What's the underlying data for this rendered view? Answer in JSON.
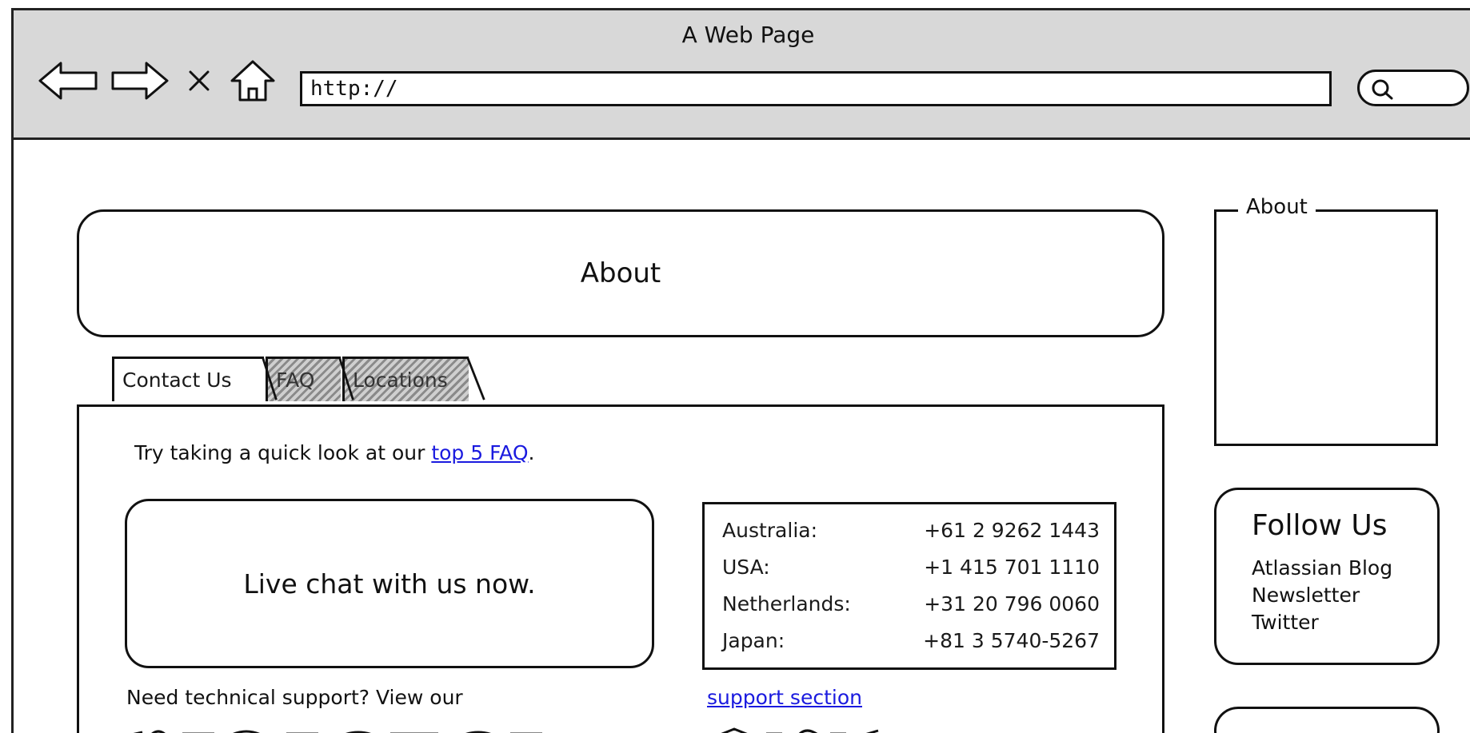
{
  "browser": {
    "window_title": "A Web Page",
    "url": "http://"
  },
  "page": {
    "header_title": "About",
    "tabs": [
      {
        "label": "Contact Us",
        "state": "active"
      },
      {
        "label": "FAQ",
        "state": "inactive"
      },
      {
        "label": "Locations",
        "state": "inactive"
      }
    ],
    "intro_text": "Try taking a quick look at our ",
    "intro_link": "top 5 FAQ",
    "intro_suffix": ".",
    "live_chat": "Live chat with us now.",
    "phones": [
      {
        "country": "Australia:",
        "number": "+61 2 9262 1443"
      },
      {
        "country": "USA:",
        "number": "+1 415 701 1110"
      },
      {
        "country": "Netherlands:",
        "number": "+31 20 796 0060"
      },
      {
        "country": "Japan:",
        "number": "+81 3 5740-5267"
      }
    ],
    "support_text": "Need technical support? View our",
    "support_link": "support section"
  },
  "sidebar": {
    "about_label": "About",
    "follow_title": "Follow Us",
    "follow_items": [
      "Atlassian Blog",
      "Newsletter",
      "Twitter"
    ]
  },
  "colors": {
    "link": "#1a1adf",
    "chrome": "#d8d8d8",
    "ink": "#111111"
  },
  "icons": {
    "back": "back-arrow-icon",
    "forward": "forward-arrow-icon",
    "stop": "close-icon",
    "home": "home-icon",
    "search": "search-icon"
  }
}
